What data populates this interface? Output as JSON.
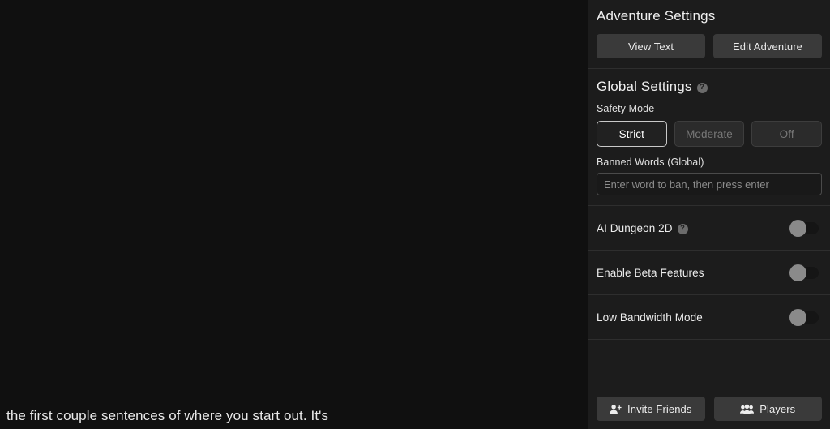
{
  "colors": {
    "panel_bg": "#1c1c1c",
    "main_bg": "#101010",
    "divider": "#2e2e2e",
    "button_bg": "#3a3a3a",
    "selected_border": "#c9c9c9",
    "toggle_knob": "#8a8a8a",
    "text_primary": "#ededed",
    "text_muted": "#787878"
  },
  "main": {
    "story_text": "the first couple sentences of where you start out. It's"
  },
  "adventure_settings": {
    "title": "Adventure Settings",
    "buttons": [
      {
        "label": "View Text",
        "name": "view-text-button"
      },
      {
        "label": "Edit Adventure",
        "name": "edit-adventure-button"
      }
    ]
  },
  "global_settings": {
    "title": "Global Settings",
    "help_icon": "help-circle-icon",
    "help_glyph": "?",
    "safety_mode": {
      "label": "Safety Mode",
      "options": [
        {
          "label": "Strict",
          "selected": true
        },
        {
          "label": "Moderate",
          "selected": false
        },
        {
          "label": "Off",
          "selected": false
        }
      ]
    },
    "banned_words": {
      "label": "Banned Words (Global)",
      "value": "",
      "placeholder": "Enter word to ban, then press enter"
    }
  },
  "toggles": [
    {
      "label": "AI Dungeon 2D",
      "has_help": true,
      "enabled": false
    },
    {
      "label": "Enable Beta Features",
      "has_help": false,
      "enabled": false
    },
    {
      "label": "Low Bandwidth Mode",
      "has_help": false,
      "enabled": false
    }
  ],
  "footer": {
    "invite": {
      "label": "Invite Friends",
      "icon": "user-plus-icon"
    },
    "players": {
      "label": "Players",
      "icon": "users-group-icon"
    }
  }
}
